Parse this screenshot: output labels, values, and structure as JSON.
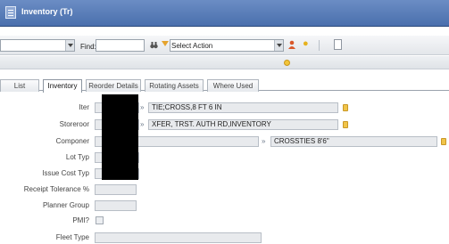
{
  "app": {
    "title": "Inventory (Tr)"
  },
  "toolbar": {
    "find_label": "Find:",
    "find_value": "",
    "action_value": "Select Action"
  },
  "tabs": [
    {
      "label": "List"
    },
    {
      "label": "Inventory"
    },
    {
      "label": "Reorder Details"
    },
    {
      "label": "Rotating Assets"
    },
    {
      "label": "Where Used"
    }
  ],
  "form": {
    "item_label": "Iter",
    "item_description": "TIE;CROSS,8 FT 6 IN",
    "storeroom_label": "Storeroor",
    "storeroom_description": "XFER, TRST. AUTH RD,INVENTORY",
    "component_label": "Componer",
    "component_description": "CROSSTIES 8'6\"",
    "lot_type_label": "Lot Typ",
    "issue_cost_type_label": "Issue Cost Typ",
    "receipt_tolerance_label": "Receipt Tolerance %",
    "planner_group_label": "Planner Group",
    "pmi_label": "PMI?",
    "fleet_type_label": "Fleet Type",
    "arrow_glyph": "»"
  },
  "colors": {
    "titlebar": "#4a6fad",
    "field_background": "#e8eaed",
    "accent_yellow": "#f0c44a"
  }
}
